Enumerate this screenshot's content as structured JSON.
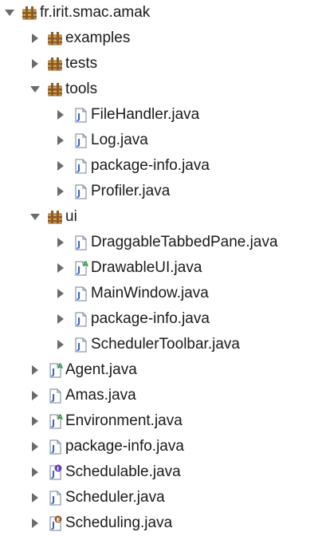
{
  "tree": {
    "rows": [
      {
        "label": "fr.irit.smac.amak",
        "depth": 0,
        "expanded": true,
        "icon": "package-icon"
      },
      {
        "label": "examples",
        "depth": 1,
        "expanded": false,
        "icon": "package-icon"
      },
      {
        "label": "tests",
        "depth": 1,
        "expanded": false,
        "icon": "package-icon"
      },
      {
        "label": "tools",
        "depth": 1,
        "expanded": true,
        "icon": "package-icon"
      },
      {
        "label": "FileHandler.java",
        "depth": 2,
        "expanded": false,
        "icon": "java-file-icon"
      },
      {
        "label": "Log.java",
        "depth": 2,
        "expanded": false,
        "icon": "java-file-icon"
      },
      {
        "label": "package-info.java",
        "depth": 2,
        "expanded": false,
        "icon": "java-file-icon"
      },
      {
        "label": "Profiler.java",
        "depth": 2,
        "expanded": false,
        "icon": "java-file-icon"
      },
      {
        "label": "ui",
        "depth": 1,
        "expanded": true,
        "icon": "package-icon"
      },
      {
        "label": "DraggableTabbedPane.java",
        "depth": 2,
        "expanded": false,
        "icon": "java-file-icon"
      },
      {
        "label": "DrawableUI.java",
        "depth": 2,
        "expanded": false,
        "icon": "java-abstract-file-icon"
      },
      {
        "label": "MainWindow.java",
        "depth": 2,
        "expanded": false,
        "icon": "java-file-icon"
      },
      {
        "label": "package-info.java",
        "depth": 2,
        "expanded": false,
        "icon": "java-file-icon"
      },
      {
        "label": "SchedulerToolbar.java",
        "depth": 2,
        "expanded": false,
        "icon": "java-file-icon"
      },
      {
        "label": "Agent.java",
        "depth": 1,
        "expanded": false,
        "icon": "java-abstract-file-icon"
      },
      {
        "label": "Amas.java",
        "depth": 1,
        "expanded": false,
        "icon": "java-file-icon"
      },
      {
        "label": "Environment.java",
        "depth": 1,
        "expanded": false,
        "icon": "java-abstract-file-icon"
      },
      {
        "label": "package-info.java",
        "depth": 1,
        "expanded": false,
        "icon": "java-file-icon"
      },
      {
        "label": "Schedulable.java",
        "depth": 1,
        "expanded": false,
        "icon": "java-interface-file-icon"
      },
      {
        "label": "Scheduler.java",
        "depth": 1,
        "expanded": false,
        "icon": "java-file-icon"
      },
      {
        "label": "Scheduling.java",
        "depth": 1,
        "expanded": false,
        "icon": "java-enum-file-icon"
      }
    ]
  },
  "colors": {
    "twisty": "#6b6b6b",
    "label": "#1a1a1a",
    "package_brown": "#8a5a2b",
    "package_gold": "#d9a441",
    "java_blue": "#3a66c4",
    "abstract_green": "#2f9a3a",
    "interface_purple": "#6a3fb2",
    "enum_brown": "#8b5a2b"
  }
}
